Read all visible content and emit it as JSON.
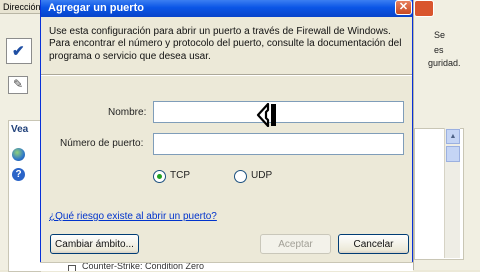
{
  "background": {
    "left_tab_label": "Dirección",
    "left_panel_label": "Vea",
    "right_fragments": [
      "Se",
      "es",
      "guridad."
    ],
    "bottom_item": "Counter-Strike: Condition Zero"
  },
  "dialog": {
    "title": "Agregar un puerto",
    "close_glyph": "✕",
    "description": "Use esta configuración para abrir un puerto a través de Firewall de Windows. Para encontrar el número y protocolo del puerto, consulte la documentación del programa o servicio que desea usar.",
    "name_label": "Nombre:",
    "name_value": "",
    "port_label": "Número de puerto:",
    "port_value": "",
    "protocol_tcp": "TCP",
    "protocol_udp": "UDP",
    "selected_protocol": "TCP",
    "risk_link": "¿Qué riesgo existe al abrir un puerto?",
    "change_scope_button": "Cambiar ámbito...",
    "accept_button": "Aceptar",
    "cancel_button": "Cancelar"
  },
  "cursor": "text-select-cursor-icon"
}
